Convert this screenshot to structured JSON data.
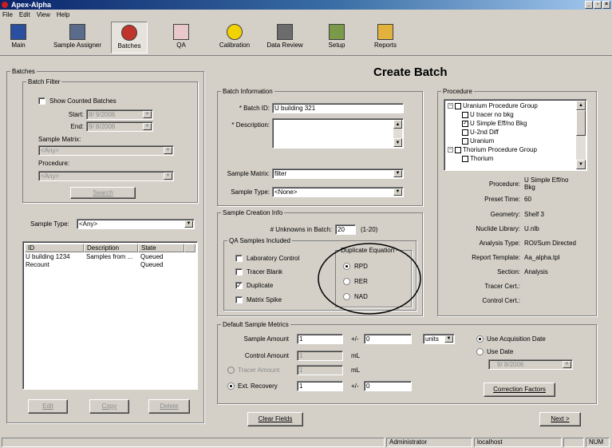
{
  "window": {
    "title": "Apex-Alpha"
  },
  "menu": [
    "File",
    "Edit",
    "View",
    "Help"
  ],
  "toolbar": [
    {
      "label": "Main",
      "icon": "main-icon"
    },
    {
      "label": "Sample Assigner",
      "icon": "sample-assigner-icon"
    },
    {
      "label": "Batches",
      "icon": "batches-icon"
    },
    {
      "label": "QA",
      "icon": "qa-icon"
    },
    {
      "label": "Calibration",
      "icon": "radiation-icon"
    },
    {
      "label": "Data Review",
      "icon": "binoculars-icon"
    },
    {
      "label": "Setup",
      "icon": "setup-icon"
    },
    {
      "label": "Reports",
      "icon": "reports-icon"
    }
  ],
  "page_title": "Create Batch",
  "batches": {
    "legend": "Batches",
    "filter": {
      "legend": "Batch Filter",
      "show_counted": "Show Counted Batches",
      "start_label": "Start:",
      "start_value": "8/ 9/2006",
      "end_label": "End:",
      "end_value": "9/ 8/2006",
      "matrix_label": "Sample Matrix:",
      "matrix_value": "<Any>",
      "procedure_label": "Procedure:",
      "procedure_value": "<Any>",
      "search": "Search"
    },
    "type_label": "Sample Type:",
    "type_value": "<Any>",
    "columns": [
      "ID",
      "Description",
      "State"
    ],
    "rows": [
      {
        "id": "U building 1234",
        "description": "Samples from ...",
        "state": "Queued"
      },
      {
        "id": "Recount",
        "description": "",
        "state": "Queued"
      }
    ],
    "buttons": {
      "edit": "Edit",
      "copy": "Copy",
      "delete": "Delete"
    }
  },
  "batch_info": {
    "legend": "Batch Information",
    "id_label": "* Batch ID:",
    "id_value": "U building 321",
    "desc_label": "* Description:",
    "desc_value": "",
    "matrix_label": "Sample Matrix:",
    "matrix_value": "filter",
    "type_label": "Sample Type:",
    "type_value": "<None>"
  },
  "creation": {
    "legend": "Sample Creation Info",
    "unknowns_label": "# Unknowns in Batch:",
    "unknowns_value": "20",
    "unknowns_range": "(1-20)",
    "qa_legend": "QA Samples Included",
    "qa": [
      {
        "label": "Laboratory Control",
        "checked": false
      },
      {
        "label": "Tracer Blank",
        "checked": false
      },
      {
        "label": "Duplicate",
        "checked": true
      },
      {
        "label": "Matrix Spike",
        "checked": false
      }
    ],
    "dup_legend": "Duplicate Equation",
    "dup": [
      {
        "label": "RPD",
        "selected": true
      },
      {
        "label": "RER",
        "selected": false
      },
      {
        "label": "NAD",
        "selected": false
      }
    ]
  },
  "procedure": {
    "legend": "Procedure",
    "tree": [
      {
        "label": "Uranium Procedure Group",
        "level": 0,
        "checked": false,
        "expander": "−"
      },
      {
        "label": "U tracer no bkg",
        "level": 1,
        "checked": false
      },
      {
        "label": "U Simple Eff/no Bkg",
        "level": 1,
        "checked": true
      },
      {
        "label": "U-2nd Diff",
        "level": 1,
        "checked": false
      },
      {
        "label": "Uranium",
        "level": 1,
        "checked": false
      },
      {
        "label": "Thorium Procedure Group",
        "level": 0,
        "checked": false,
        "expander": "−"
      },
      {
        "label": "Thorium",
        "level": 1,
        "checked": false
      }
    ],
    "details": [
      {
        "label": "Procedure:",
        "value": "U Simple Eff/no Bkg"
      },
      {
        "label": "Preset Time:",
        "value": "60"
      },
      {
        "label": "Geometry:",
        "value": "Shelf 3"
      },
      {
        "label": "Nuclide Library:",
        "value": "U.nlb"
      },
      {
        "label": "Analysis Type:",
        "value": "ROI/Sum Directed"
      },
      {
        "label": "Report Template:",
        "value": "Aa_alpha.tpl"
      },
      {
        "label": "Section:",
        "value": "Analysis"
      },
      {
        "label": "Tracer Cert.:",
        "value": ""
      },
      {
        "label": "Control Cert.:",
        "value": ""
      }
    ]
  },
  "metrics": {
    "legend": "Default Sample Metrics",
    "sample_amount_label": "Sample Amount",
    "sample_amount": "1",
    "pm": "+/-",
    "uncert": "0",
    "units": "units",
    "control_amount_label": "Control Amount",
    "control_amount": "1",
    "control_unit": "mL",
    "tracer_amount_label": "Tracer Amount",
    "tracer_amount": "1",
    "tracer_unit": "mL",
    "ext_recovery_label": "Ext. Recovery",
    "ext_recovery": "1",
    "ext_uncert": "0",
    "use_acq": "Use Acquisition Date",
    "use_date": "Use Date",
    "date_value": "9/ 8/2006",
    "correction": "Correction Factors"
  },
  "footer": {
    "clear": "Clear Fields",
    "next": "Next >"
  },
  "status": {
    "user": "Administrator",
    "host": "localhost",
    "num": "NUM"
  }
}
